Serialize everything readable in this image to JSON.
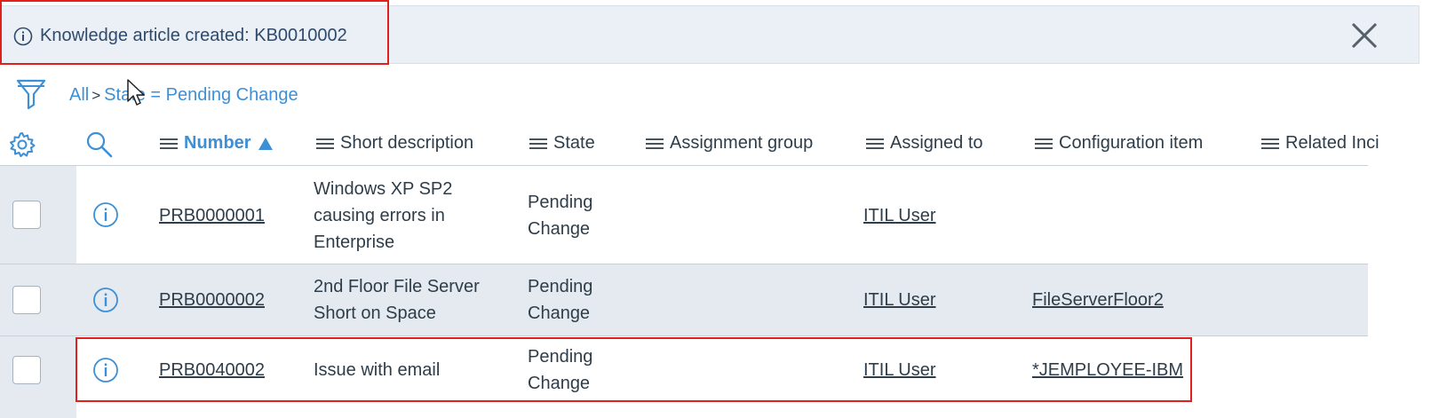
{
  "notification": {
    "message": "Knowledge article created: KB0010002"
  },
  "breadcrumb": {
    "all": "All",
    "separator": ">",
    "filter": "State = Pending Change"
  },
  "columns": {
    "number": "Number",
    "short_description": "Short description",
    "state": "State",
    "assignment_group": "Assignment group",
    "assigned_to": "Assigned to",
    "configuration_item": "Configuration item",
    "related_incidents": "Related Inci"
  },
  "rows": [
    {
      "number": "PRB0000001",
      "desc_lines": [
        "Windows XP SP2",
        "causing errors in",
        "Enterprise"
      ],
      "state_lines": [
        "Pending",
        "Change"
      ],
      "assignment_group": "",
      "assigned_to": "ITIL User",
      "configuration_item": ""
    },
    {
      "number": "PRB0000002",
      "desc_lines": [
        "2nd Floor File Server",
        "Short on Space"
      ],
      "state_lines": [
        "Pending",
        "Change"
      ],
      "assignment_group": "",
      "assigned_to": "ITIL User",
      "configuration_item": "FileServerFloor2"
    },
    {
      "number": "PRB0040002",
      "desc_lines": [
        "Issue with email"
      ],
      "state_lines": [
        "Pending",
        "Change"
      ],
      "assignment_group": "",
      "assigned_to": "ITIL User",
      "configuration_item": "*JEMPLOYEE-IBM"
    }
  ],
  "colors": {
    "accent": "#3d8fd6",
    "highlight_box": "#e0201c",
    "banner_bg": "#eaf0f6",
    "row_alt_bg": "#e4eaf0"
  },
  "icons": [
    "info-icon",
    "close-icon",
    "filter-icon",
    "gear-icon",
    "search-icon",
    "menu-icon",
    "sort-ascending-icon",
    "cursor-pointer"
  ]
}
